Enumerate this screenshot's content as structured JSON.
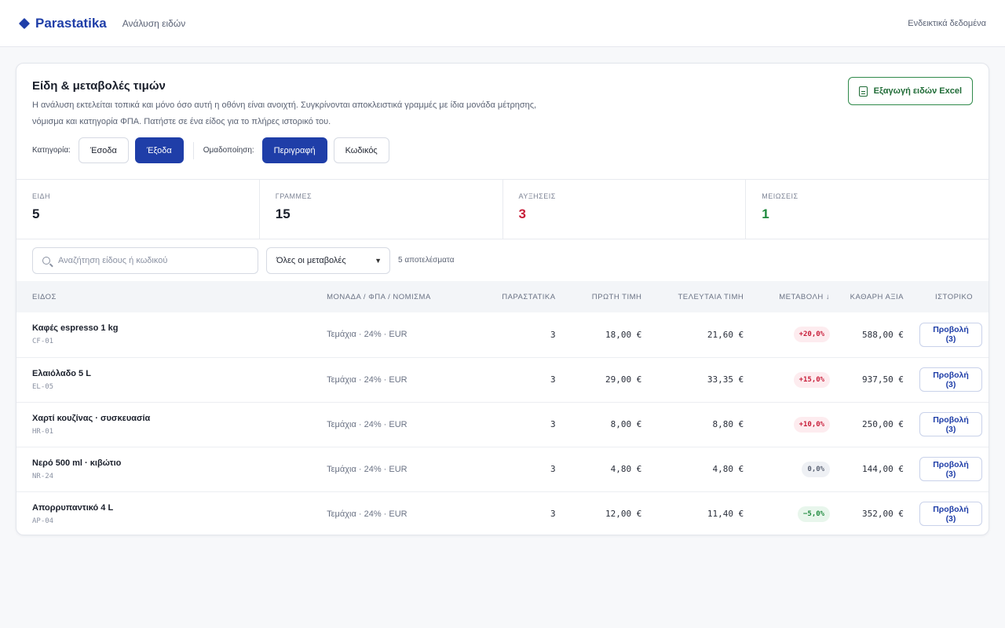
{
  "header": {
    "brand": "Parastatika",
    "brand_icon": "diamond-icon",
    "subtitle": "Ανάλυση ειδών",
    "right_label": "Ενδεικτικά δεδομένα"
  },
  "card": {
    "title": "Είδη & μεταβολές τιμών",
    "description": "Η ανάλυση εκτελείται τοπικά και μόνο όσο αυτή η οθόνη είναι ανοιχτή. Συγκρίνονται αποκλειστικά γραμμές με ίδια μονάδα μέτρησης, νόμισμα και κατηγορία ΦΠΑ. Πατήστε σε ένα είδος για το πλήρες ιστορικό του.",
    "export_label": "Εξαγωγή ειδών Excel",
    "export_icon": "document-icon"
  },
  "filters": {
    "category_label": "Κατηγορία:",
    "category_options": [
      "Έσοδα",
      "Έξοδα"
    ],
    "category_selected": "Έξοδα",
    "grouping_label": "Ομαδοποίηση:",
    "grouping_options": [
      "Περιγραφή",
      "Κωδικός"
    ],
    "grouping_selected": "Περιγραφή"
  },
  "stats": [
    {
      "label": "ΕΙΔΗ",
      "value": "5",
      "tone": "neutral"
    },
    {
      "label": "ΓΡΑΜΜΕΣ",
      "value": "15",
      "tone": "neutral"
    },
    {
      "label": "ΑΥΞΗΣΕΙΣ",
      "value": "3",
      "tone": "up"
    },
    {
      "label": "ΜΕΙΩΣΕΙΣ",
      "value": "1",
      "tone": "down"
    }
  ],
  "toolbar": {
    "search_placeholder": "Αναζήτηση είδους ή κωδικού",
    "search_icon": "search-icon",
    "change_filter": "Όλες οι μεταβολές",
    "results": "5 αποτελέσματα"
  },
  "table": {
    "columns": [
      "ΕΙΔΟΣ",
      "ΜΟΝΑΔΑ / ΦΠΑ / ΝΟΜΙΣΜΑ",
      "ΠΑΡΑΣΤΑΤΙΚΑ",
      "ΠΡΩΤΗ ΤΙΜΗ",
      "ΤΕΛΕΥΤΑΙΑ ΤΙΜΗ",
      "ΜΕΤΑΒΟΛΗ ↓",
      "ΚΑΘΑΡΗ ΑΞΙΑ",
      "ΙΣΤΟΡΙΚΟ"
    ],
    "rows": [
      {
        "name": "Καφές espresso 1 kg",
        "code": "CF-01",
        "unit": "Τεμάχια · 24% · EUR",
        "docs": "3",
        "first": "18,00 €",
        "last": "21,60 €",
        "change": "+20,0%",
        "tone": "up",
        "net": "588,00 €",
        "history": "Προβολή (3)"
      },
      {
        "name": "Ελαιόλαδο 5 L",
        "code": "EL-05",
        "unit": "Τεμάχια · 24% · EUR",
        "docs": "3",
        "first": "29,00 €",
        "last": "33,35 €",
        "change": "+15,0%",
        "tone": "up",
        "net": "937,50 €",
        "history": "Προβολή (3)"
      },
      {
        "name": "Χαρτί κουζίνας · συσκευασία",
        "code": "HR-01",
        "unit": "Τεμάχια · 24% · EUR",
        "docs": "3",
        "first": "8,00 €",
        "last": "8,80 €",
        "change": "+10,0%",
        "tone": "up",
        "net": "250,00 €",
        "history": "Προβολή (3)"
      },
      {
        "name": "Νερό 500 ml · κιβώτιο",
        "code": "NR-24",
        "unit": "Τεμάχια · 24% · EUR",
        "docs": "3",
        "first": "4,80 €",
        "last": "4,80 €",
        "change": "0,0%",
        "tone": "zero",
        "net": "144,00 €",
        "history": "Προβολή (3)"
      },
      {
        "name": "Απορρυπαντικό 4 L",
        "code": "AP-04",
        "unit": "Τεμάχια · 24% · EUR",
        "docs": "3",
        "first": "12,00 €",
        "last": "11,40 €",
        "change": "−5,0%",
        "tone": "down",
        "net": "352,00 €",
        "history": "Προβολή (3)"
      }
    ]
  },
  "colors": {
    "accent": "#1f3ea8",
    "increase": "#c81e3a",
    "decrease": "#1f8a3e",
    "export": "#2f8a4a"
  }
}
